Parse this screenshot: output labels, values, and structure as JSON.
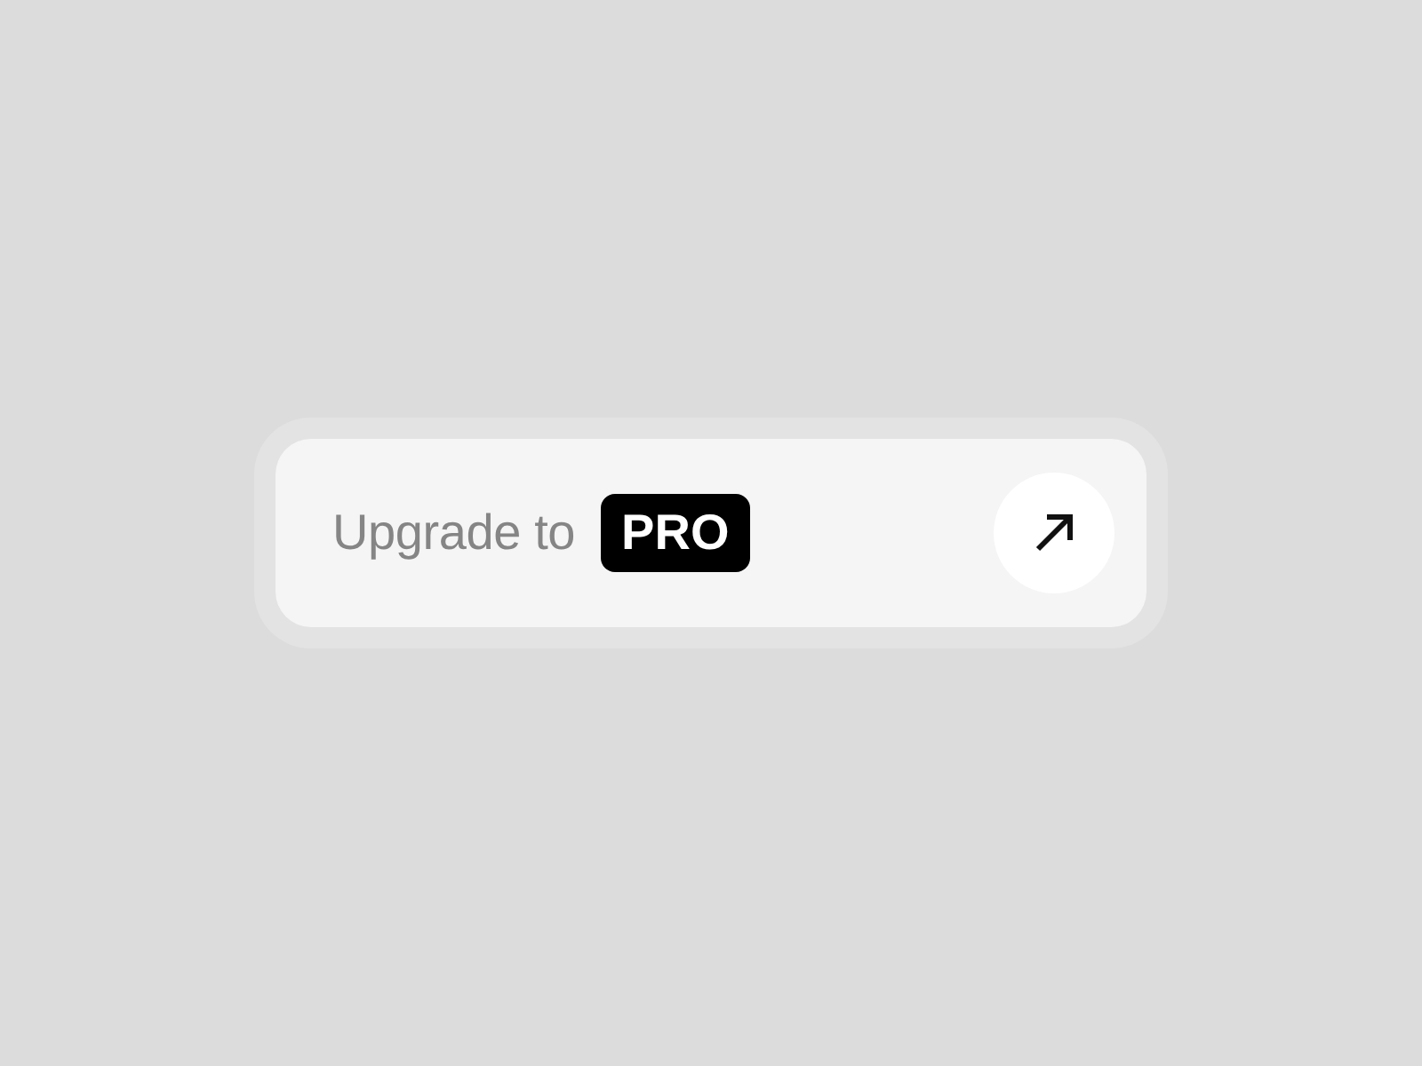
{
  "upgrade_card": {
    "label": "Upgrade to",
    "badge": "PRO"
  }
}
